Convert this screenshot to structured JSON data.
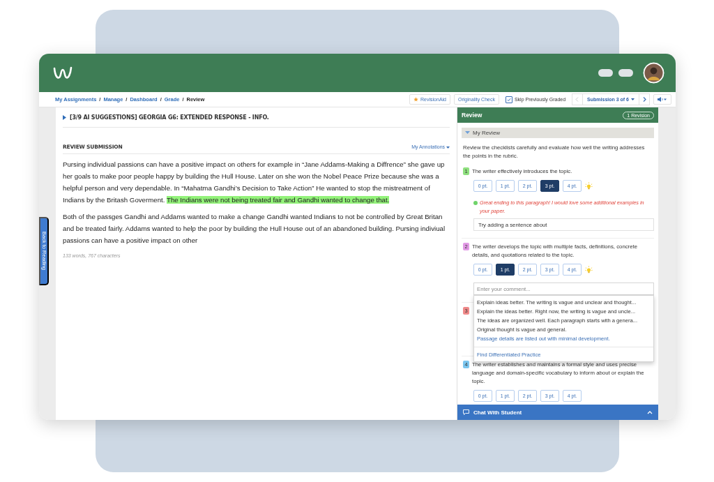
{
  "breadcrumbs": [
    {
      "label": "My Assignments",
      "current": false
    },
    {
      "label": "Manage",
      "current": false
    },
    {
      "label": "Dashboard",
      "current": false
    },
    {
      "label": "Grade",
      "current": false
    },
    {
      "label": "Review",
      "current": true
    }
  ],
  "breadcrumb_separator": "/",
  "toolbar": {
    "revision_aid": "RevisionAid",
    "originality_check": "Originality Check",
    "skip_graded": {
      "label": "Skip Previously Graded",
      "checked": true
    },
    "previous_disabled": true,
    "submission": "Submission 3 of 6"
  },
  "assignment": {
    "title": "[3/9 AI SUGGESTIONS] GEORGIA G6: EXTENDED RESPONSE - INFO.",
    "expanded": false
  },
  "submission": {
    "heading": "REVIEW SUBMISSION",
    "annotations": "My Annotations",
    "paragraphs": [
      [
        {
          "text": "Pursing individual passions can have a positive impact on others for example in “Jane Addams-Making a Diffrence” she gave up her goals to make poor people happy by building the Hull House. Later on she won the Nobel Peace Prize because she was a helpful person and very dependable. In “Mahatma Gandhi’s Decision to Take Action” He wanted to stop the mistreatment of Indians by the Britash Goverment. ",
          "highlighted": false
        },
        {
          "text": "The Indians were not being treated fair and Gandhi wanted to change that.",
          "highlighted": true
        }
      ],
      [
        {
          "text": "Both of the passges Gandhi and Addams wanted to make a change Gandhi wanted Indians to not be controlled by Great Britan and be treated fairly. Addams wanted to help the poor by building the Hull House out of an abandoned building. Pursing indiviual passions can have a positive impact on other",
          "highlighted": false
        }
      ]
    ],
    "stats": "133 words, 767 characters"
  },
  "side_tab": "Back to Reading",
  "review": {
    "title": "Review",
    "revisions": "1 Revision",
    "section": {
      "label": "My Review",
      "expanded": true
    },
    "intro": "Review the checklists carefully and evaluate how well the writing addresses the points in the rubric.",
    "criteria": [
      {
        "number": "1",
        "color": "#8fe07f",
        "text": "The writer effectively introduces the topic.",
        "hint": true,
        "scores": [
          {
            "label": "0 pt.",
            "selected": false
          },
          {
            "label": "1 pt.",
            "selected": false
          },
          {
            "label": "2 pt.",
            "selected": false
          },
          {
            "label": "3 pt.",
            "selected": true
          },
          {
            "label": "4 pt.",
            "selected": false
          }
        ],
        "feedback": "Great ending to this paragraph! I would love some additional examples in your paper.",
        "comment": {
          "value": "Try adding a sentence about"
        }
      },
      {
        "number": "2",
        "color": "#e29be6",
        "text": "The writer develops the topic with multiple facts, definitions, concrete details, and quotations related to the topic.",
        "hint": true,
        "scores": [
          {
            "label": "0 pt.",
            "selected": false
          },
          {
            "label": "1 pt.",
            "selected": true
          },
          {
            "label": "2 pt.",
            "selected": false
          },
          {
            "label": "3 pt.",
            "selected": false
          },
          {
            "label": "4 pt.",
            "selected": false
          }
        ],
        "comment": {
          "placeholder": "Enter your comment...",
          "suggestions": [
            {
              "kind": "suggestion",
              "text": "Explain ideas better. The writing is vague and unclear and thought..."
            },
            {
              "kind": "suggestion",
              "text": "Explain the ideas better. Right now, the writing is vague and uncle..."
            },
            {
              "kind": "suggestion",
              "text": "The ideas are organized well. Each paragraph starts with a genera..."
            },
            {
              "kind": "suggestion",
              "text": "Original thought is vague and general."
            },
            {
              "kind": "link",
              "text": "Passage details are listed out with minimal development."
            },
            {
              "kind": "action",
              "text": "Find Differentiated Practice"
            }
          ]
        }
      },
      {
        "number": "3",
        "color": "#f08a8a"
      },
      {
        "number": "4",
        "color": "#7cc6ef",
        "text": "The writer establishes and maintains a formal style and uses precise language and domain-specific vocabulary to inform about or explain the topic.",
        "hint": false,
        "scores": [
          {
            "label": "0 pt.",
            "selected": false
          },
          {
            "label": "1 pt.",
            "selected": false
          },
          {
            "label": "2 pt.",
            "selected": false
          },
          {
            "label": "3 pt.",
            "selected": false
          },
          {
            "label": "4 pt.",
            "selected": false
          }
        ]
      }
    ],
    "chat": {
      "label": "Chat With Student",
      "expanded": false
    }
  }
}
